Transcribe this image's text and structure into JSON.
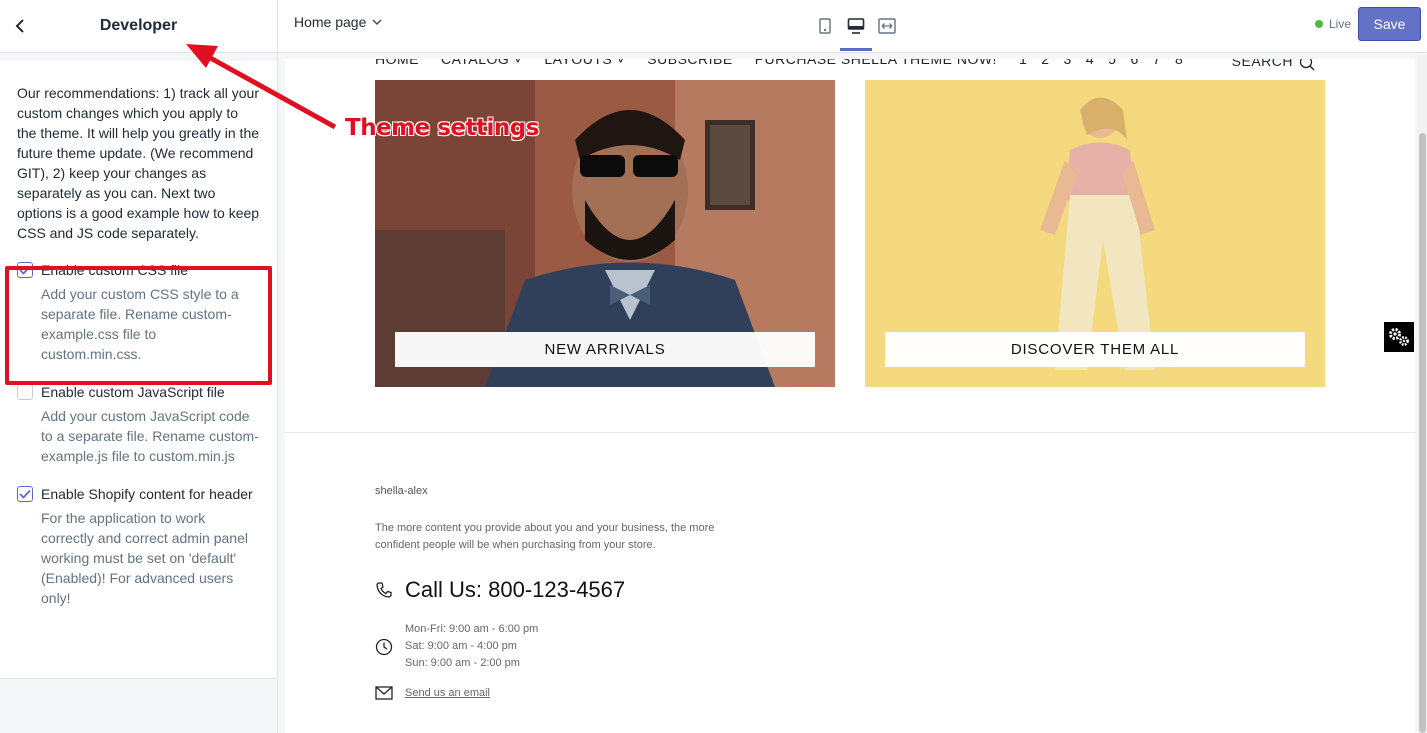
{
  "sidebar": {
    "title": "Developer",
    "description": "Our recommendations: 1) track all your custom changes which you apply to the theme. It will help you greatly in the future theme update. (We recommend GIT), 2) keep your changes as separately as you can. Next two options is a good example how to keep CSS and JS code separately.",
    "options": [
      {
        "label": "Enable custom CSS file",
        "help": "Add your custom CSS style to a separate file. Rename custom-example.css file to custom.min.css.",
        "checked": true
      },
      {
        "label": "Enable custom JavaScript file",
        "help": "Add your custom JavaScript code to a separate file. Rename custom-example.js file to custom.min.js",
        "checked": false
      },
      {
        "label": "Enable Shopify content for header",
        "help": "For the application to work correctly and correct admin panel working must be set on 'default' (Enabled)! For advanced users only!",
        "checked": true
      }
    ]
  },
  "topbar": {
    "page_select": "Home page",
    "status": "Live",
    "save_label": "Save",
    "active_device": "desktop"
  },
  "preview": {
    "nav": {
      "items": [
        "HOME",
        "CATALOG ˅",
        "LAYOUTS ˅",
        "SUBSCRIBE",
        "PURCHASE SHELLA THEME NOW!"
      ],
      "numbers": [
        "1",
        "2",
        "3",
        "4",
        "5",
        "6",
        "7",
        "8"
      ],
      "search": "SEARCH"
    },
    "banners": [
      {
        "label": "NEW ARRIVALS"
      },
      {
        "label": "DISCOVER THEM ALL"
      }
    ],
    "footer": {
      "brand": "shella-alex",
      "description": "The more content you provide about you and your business, the more confident people will be when purchasing from your store.",
      "call": "Call Us: 800-123-4567",
      "hours": [
        "Mon-Fri: 9:00 am - 6:00 pm",
        "Sat: 9:00 am - 4:00 pm",
        "Sun: 9:00 am - 2:00 pm"
      ],
      "email_link": "Send us an email"
    }
  },
  "annotation": {
    "text": "Theme settings",
    "color": "#e01020"
  },
  "colors": {
    "accent": "#5c6ac4",
    "save_button": "#6371c7",
    "live_dot": "#50b83c"
  }
}
